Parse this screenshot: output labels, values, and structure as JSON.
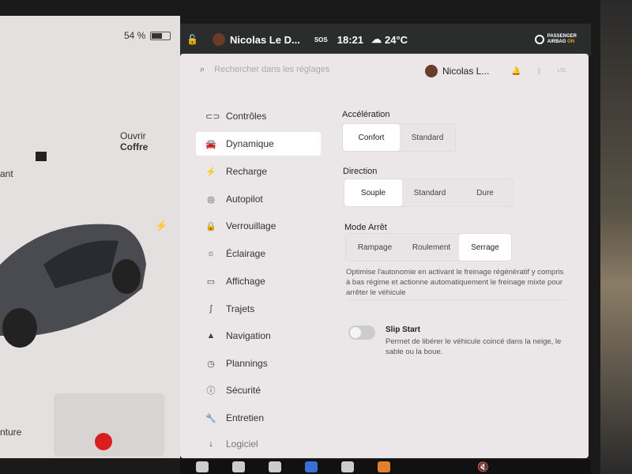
{
  "left_panel": {
    "battery": "54 %",
    "battery_level": 54,
    "partial_label_left": "ant",
    "trunk_action": "Ouvrir",
    "trunk_label": "Coffre",
    "seat_partial": "nture"
  },
  "status_bar": {
    "driver": "Nicolas Le D...",
    "sos": "SOS",
    "time": "18:21",
    "temperature": "24°C",
    "airbag_line1": "PASSENGER",
    "airbag_line2": "AIRBAG",
    "airbag_state": "ON",
    "airbag_state_color": "#f39c12"
  },
  "header": {
    "search_placeholder": "Rechercher dans les réglages",
    "user": "Nicolas L...",
    "lte": "LTE"
  },
  "sidebar": {
    "items": [
      {
        "label": "Contrôles",
        "icon": "toggle-icon"
      },
      {
        "label": "Dynamique",
        "icon": "car-icon",
        "active": true
      },
      {
        "label": "Recharge",
        "icon": "bolt-icon"
      },
      {
        "label": "Autopilot",
        "icon": "steering-wheel-icon"
      },
      {
        "label": "Verrouillage",
        "icon": "lock-icon"
      },
      {
        "label": "Éclairage",
        "icon": "sun-icon"
      },
      {
        "label": "Affichage",
        "icon": "display-icon"
      },
      {
        "label": "Trajets",
        "icon": "route-icon"
      },
      {
        "label": "Navigation",
        "icon": "navigation-icon"
      },
      {
        "label": "Plannings",
        "icon": "clock-icon"
      },
      {
        "label": "Sécurité",
        "icon": "alert-icon"
      },
      {
        "label": "Entretien",
        "icon": "wrench-icon"
      },
      {
        "label": "Logiciel",
        "icon": "download-icon"
      }
    ]
  },
  "settings": {
    "acceleration": {
      "title": "Accélération",
      "options": [
        "Confort",
        "Standard"
      ],
      "selected": 0
    },
    "direction": {
      "title": "Direction",
      "options": [
        "Souple",
        "Standard",
        "Dure"
      ],
      "selected": 0
    },
    "stop_mode": {
      "title": "Mode Arrêt",
      "options": [
        "Rampage",
        "Roulement",
        "Serrage"
      ],
      "selected": 2,
      "description": "Optimise l'autonomie en activant le freinage régénératif y compris à bas régime et actionne automatiquement le freinage mixte pour arrêter le véhicule"
    },
    "slip_start": {
      "title": "Slip Start",
      "enabled": false,
      "description": "Permet de libérer le véhicule coincé dans la neige, le sable ou la boue."
    }
  }
}
